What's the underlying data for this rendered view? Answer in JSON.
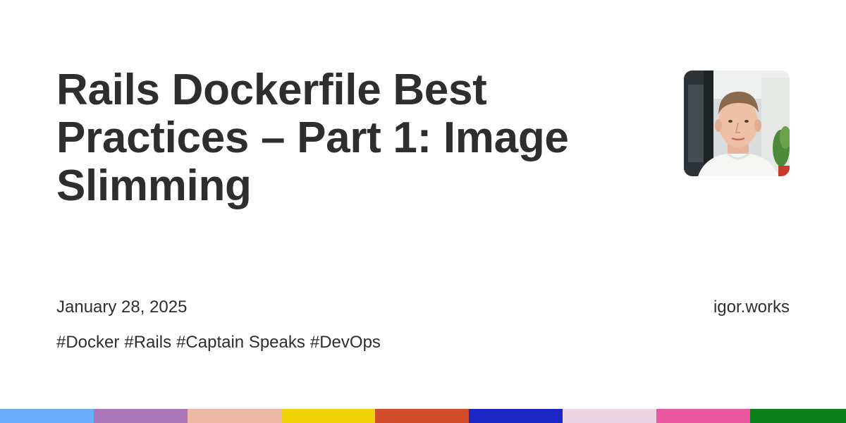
{
  "post": {
    "title": "Rails Dockerfile Best Practices – Part 1: Image Slimming",
    "date": "January 28, 2025",
    "site": "igor.works",
    "tags": [
      "#Docker",
      "#Rails",
      "#Captain Speaks",
      "#DevOps"
    ]
  },
  "colors": {
    "text": "#2e2e2e",
    "background": "#ffffff",
    "bar_segments": [
      "#6aaefb",
      "#ab77b8",
      "#edb9a6",
      "#efd308",
      "#d24c2c",
      "#1b25c4",
      "#ebd5e2",
      "#ea58a0",
      "#0c7f1c"
    ]
  },
  "icons": {
    "avatar": "author-photo"
  }
}
